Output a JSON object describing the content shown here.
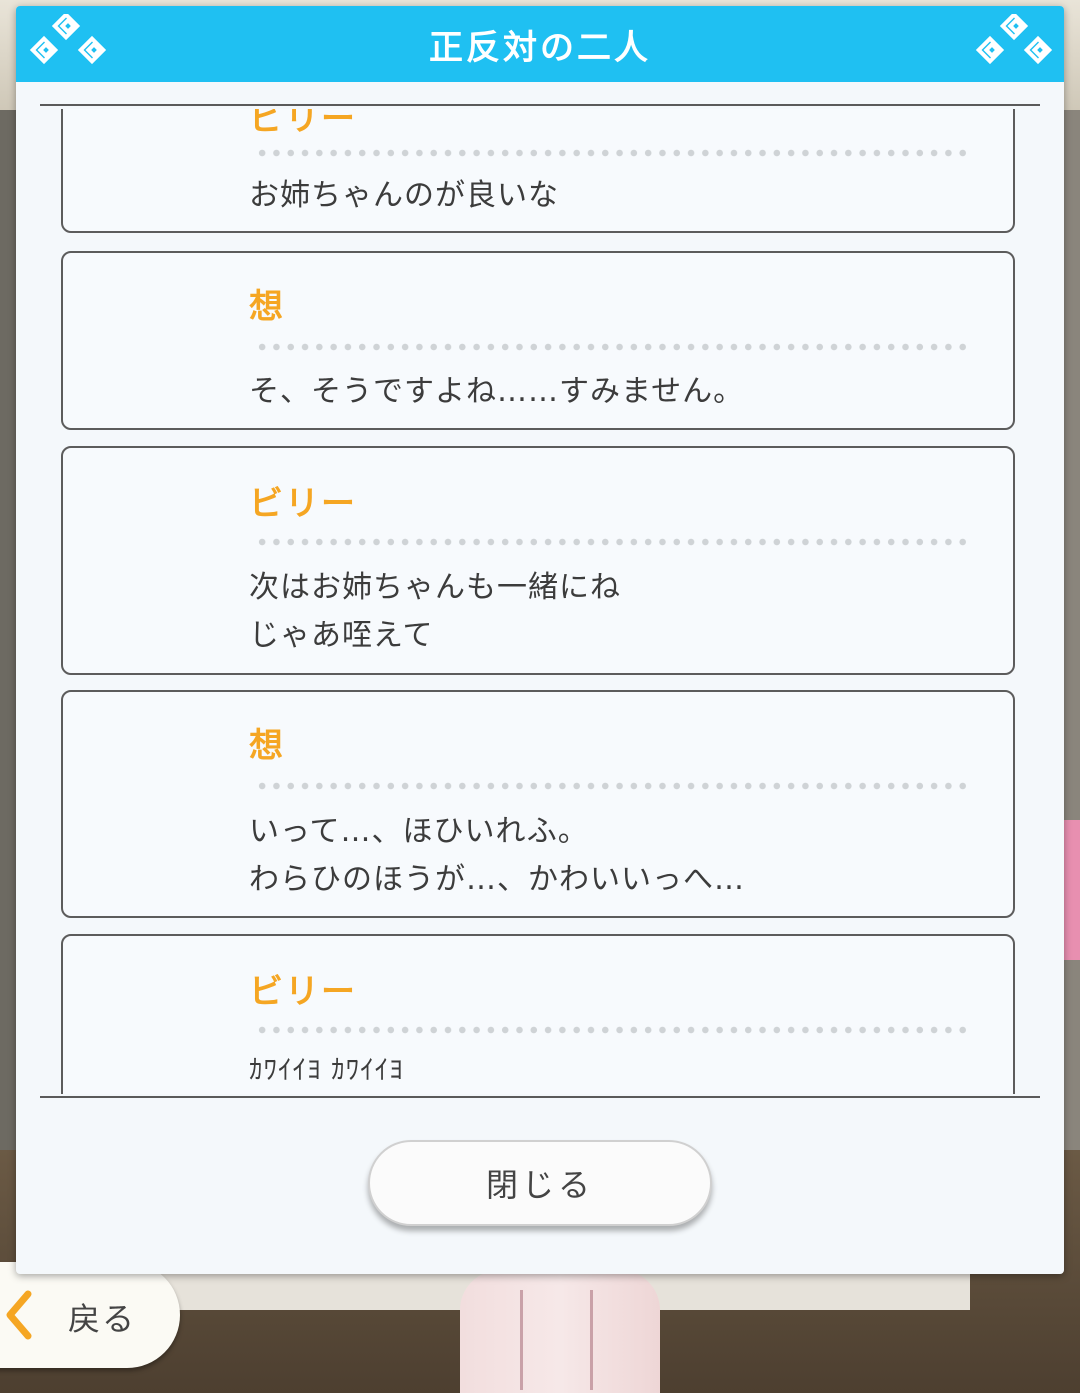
{
  "modal": {
    "title": "正反対の二人",
    "close_label": "閉じる"
  },
  "back_button": {
    "label": "戻る"
  },
  "log": [
    {
      "speaker": "ビリー",
      "lines": [
        "お姉ちゃんのが良いな"
      ]
    },
    {
      "speaker": "想",
      "lines": [
        "そ、そうですよね……すみません。"
      ]
    },
    {
      "speaker": "ビリー",
      "lines": [
        "次はお姉ちゃんも一緒にね",
        "じゃあ咥えて"
      ]
    },
    {
      "speaker": "想",
      "lines": [
        "いって…、ほひいれふ。",
        "わらひのほうが…、かわいいっへ…"
      ]
    },
    {
      "speaker": "ビリー",
      "lines": [
        "ｶﾜｲｲﾖ ｶﾜｲｲﾖ"
      ]
    }
  ],
  "colors": {
    "header": "#1fc0f2",
    "speaker": "#f5a623",
    "text": "#3c3c3c"
  },
  "icons": [
    "diamond-ornament-icon",
    "chevron-left-icon"
  ]
}
